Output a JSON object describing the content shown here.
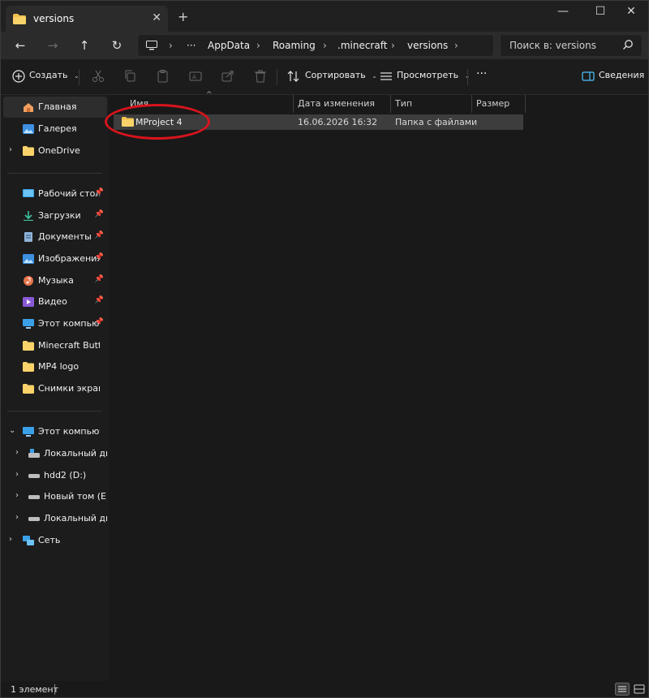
{
  "tab": {
    "title": "versions",
    "close_glyph": "✕",
    "new_tab_glyph": "+"
  },
  "window_controls": {
    "minimize": "—",
    "maximize": "☐",
    "close": "✕"
  },
  "nav": {
    "back": "←",
    "forward": "→",
    "up": "↑",
    "refresh": "↻",
    "more_crumbs": "···",
    "breadcrumbs": [
      "AppData",
      "Roaming",
      ".minecraft",
      "versions"
    ],
    "search_placeholder": "Поиск в: versions"
  },
  "commands": {
    "create": "Создать",
    "sort": "Сортировать",
    "view": "Просмотреть",
    "more": "···",
    "details": "Сведения"
  },
  "sidebar": {
    "items": [
      {
        "label": "Главная",
        "icon": "home-icon",
        "selected": true
      },
      {
        "label": "Галерея",
        "icon": "gallery-icon"
      },
      {
        "label": "OneDrive",
        "icon": "folder-icon",
        "expandable": true
      }
    ],
    "pinned": [
      {
        "label": "Рабочий стол",
        "icon": "desktop-icon",
        "pinned": true
      },
      {
        "label": "Загрузки",
        "icon": "download-icon",
        "pinned": true
      },
      {
        "label": "Документы",
        "icon": "documents-icon",
        "pinned": true
      },
      {
        "label": "Изображения",
        "icon": "pictures-icon",
        "pinned": true
      },
      {
        "label": "Музыка",
        "icon": "music-icon",
        "pinned": true
      },
      {
        "label": "Видео",
        "icon": "video-icon",
        "pinned": true
      },
      {
        "label": "Этот компьютер",
        "icon": "computer-icon",
        "pinned": true
      },
      {
        "label": "Minecraft Button",
        "icon": "folder-icon"
      },
      {
        "label": "MP4 logo",
        "icon": "folder-icon"
      },
      {
        "label": "Снимки экрана",
        "icon": "folder-icon"
      }
    ],
    "tree": [
      {
        "label": "Этот компьютер",
        "icon": "computer-icon",
        "expanded": true
      },
      {
        "label": "Локальный диск",
        "icon": "drive-icon"
      },
      {
        "label": "hdd2 (D:)",
        "icon": "drive-icon"
      },
      {
        "label": "Новый том (E:)",
        "icon": "drive-icon"
      },
      {
        "label": "Локальный диск",
        "icon": "drive-icon"
      },
      {
        "label": "Сеть",
        "icon": "network-icon"
      }
    ]
  },
  "table": {
    "columns": [
      "Имя",
      "Дата изменения",
      "Тип",
      "Размер"
    ],
    "rows": [
      {
        "name": "MProject 4",
        "date": "16.06.2026 16:32",
        "type": "Папка с файлами",
        "size": ""
      }
    ]
  },
  "status": {
    "count": "1 элемент"
  },
  "colors": {
    "annotation_circle": "#d9141d",
    "folder": "#f2c14e",
    "accent": "#4cc2ff"
  }
}
